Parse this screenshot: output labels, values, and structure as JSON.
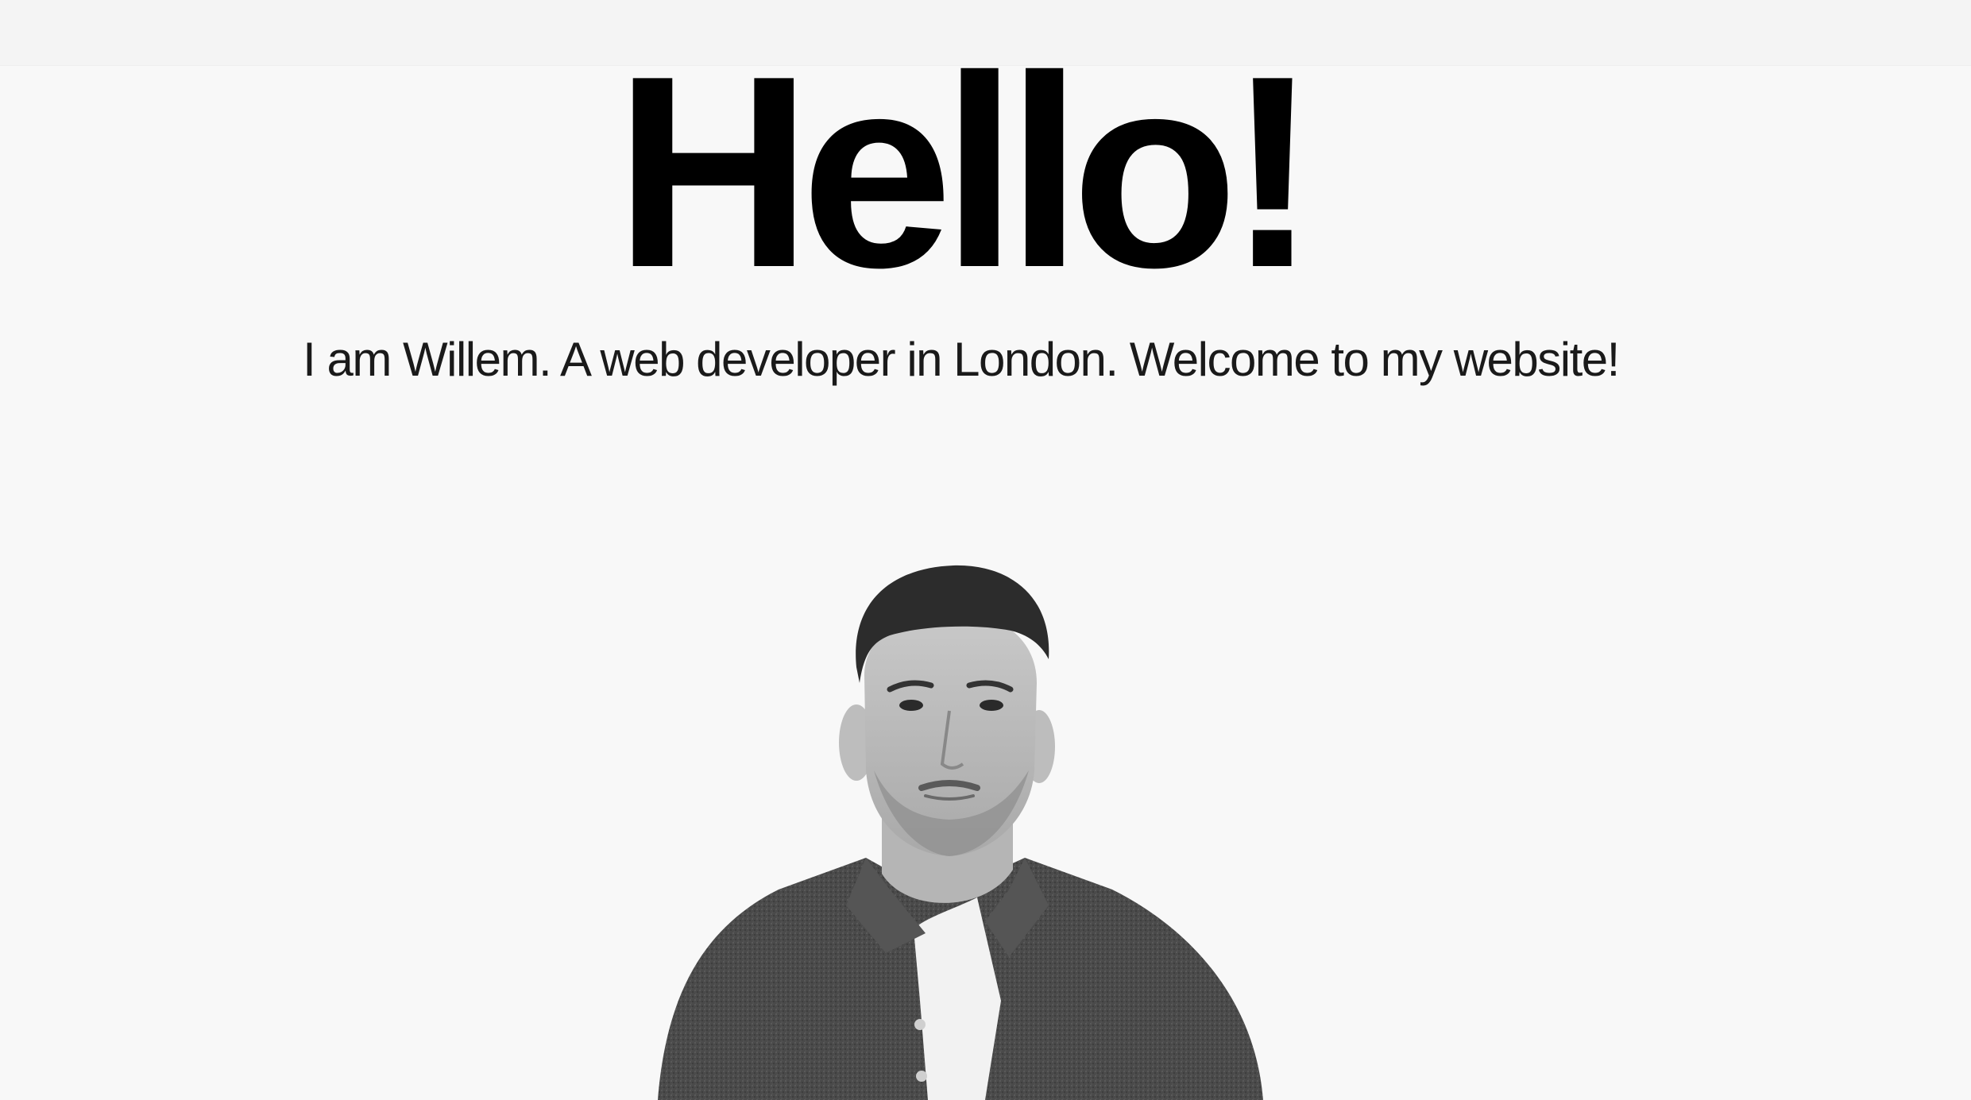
{
  "hero": {
    "title": "Hello!",
    "intro": "I am Willem. A web developer in London. Welcome to my website!"
  },
  "portrait": {
    "subject": "Willem",
    "style": "black-and-white cutout photo"
  },
  "colors": {
    "background": "#f8f8f8",
    "text": "#000000"
  }
}
